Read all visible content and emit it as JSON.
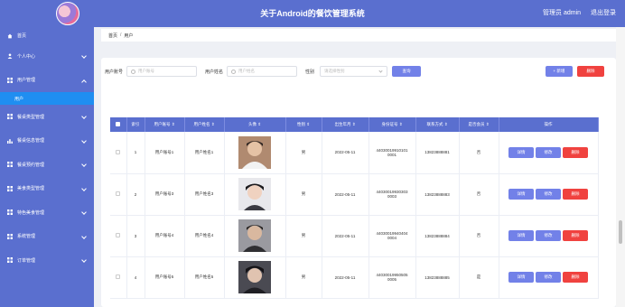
{
  "header": {
    "title": "关于Android的餐饮管理系统",
    "user": "管理员 admin",
    "logout": "退出登录"
  },
  "sidebar": {
    "items": [
      {
        "label": "首页",
        "icon": "home-icon"
      },
      {
        "label": "个人中心",
        "icon": "user-icon"
      },
      {
        "label": "用户管理",
        "icon": "grid-icon",
        "sub": "用户"
      },
      {
        "label": "餐桌类型管理",
        "icon": "grid-icon"
      },
      {
        "label": "餐桌信息管理",
        "icon": "bar-chart-icon"
      },
      {
        "label": "餐桌预约管理",
        "icon": "grid-icon"
      },
      {
        "label": "美食类型管理",
        "icon": "grid-icon"
      },
      {
        "label": "特色美食管理",
        "icon": "grid-icon"
      },
      {
        "label": "系统管理",
        "icon": "grid-icon"
      },
      {
        "label": "订单管理",
        "icon": "grid-icon"
      }
    ]
  },
  "breadcrumb": {
    "home": "首页",
    "separator": "/",
    "current": "用户"
  },
  "search": {
    "account_label": "用户账号",
    "account_placeholder": "用户账号",
    "name_label": "用户姓名",
    "name_placeholder": "用户姓名",
    "gender_label": "性别",
    "gender_placeholder": "请选择性别",
    "query_button": "查询",
    "add_button": "+ 新增",
    "delete_button": "删除"
  },
  "table": {
    "headers": [
      "索引",
      "用户账号 ⇕",
      "用户姓名 ⇕",
      "头像 ⇕",
      "性别 ⇕",
      "出生年月 ⇕",
      "身份证号 ⇕",
      "联系方式 ⇕",
      "是否会员 ⇕",
      "操作"
    ],
    "rows": [
      {
        "index": "1",
        "account": "用户账号1",
        "name": "用户姓名1",
        "gender": "男",
        "birth": "2022-05-11",
        "id_line1": "44030019910101",
        "id_line2": "0001",
        "phone": "13823888881",
        "member": "否"
      },
      {
        "index": "2",
        "account": "用户账号3",
        "name": "用户姓名3",
        "gender": "男",
        "birth": "2022-05-11",
        "id_line1": "44030019930303",
        "id_line2": "0003",
        "phone": "13823888883",
        "member": "否"
      },
      {
        "index": "3",
        "account": "用户账号4",
        "name": "用户姓名4",
        "gender": "男",
        "birth": "2022-05-11",
        "id_line1": "44030019940404",
        "id_line2": "0004",
        "phone": "13823888884",
        "member": "否"
      },
      {
        "index": "4",
        "account": "用户账号5",
        "name": "用户姓名5",
        "gender": "男",
        "birth": "2022-05-11",
        "id_line1": "44030019950505",
        "id_line2": "0005",
        "phone": "13823888885",
        "member": "是"
      }
    ],
    "actions": {
      "detail": "详情",
      "edit": "修改",
      "delete": "删除"
    }
  },
  "colors": {
    "primary": "#5a6fcf",
    "active": "#1f8ef1",
    "button": "#7281e8",
    "danger": "#f0423f"
  }
}
